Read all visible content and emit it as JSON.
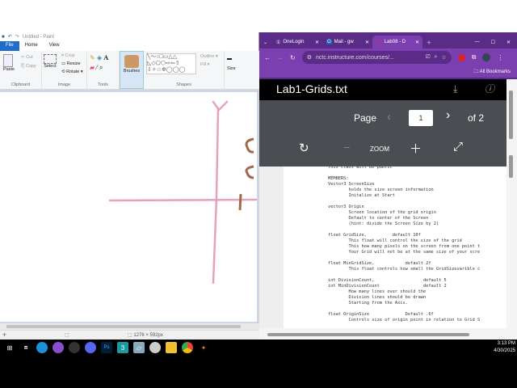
{
  "paint": {
    "title": "Untitled - Paint",
    "tabs": [
      "File",
      "Home",
      "View"
    ],
    "clipboard": {
      "paste": "Paste",
      "cut": "Cut",
      "copy": "Copy",
      "label": "Clipboard"
    },
    "image": {
      "select": "Select",
      "crop": "Crop",
      "resize": "Resize",
      "rotate": "Rotate",
      "label": "Image"
    },
    "tools": {
      "label": "Tools"
    },
    "brushes": "Brushes",
    "shapes": {
      "outline": "Outline",
      "fill": "Fill",
      "label": "Shapes"
    },
    "size": "Size",
    "status": {
      "dimensions": "1276 × 592px"
    },
    "stroke_color": "#e8a0c0",
    "brown": "#a0694a"
  },
  "browser": {
    "tabs": [
      {
        "label": "OneLogin"
      },
      {
        "label": "Mail - gw"
      },
      {
        "label": "Lab08 - D"
      }
    ],
    "url": "nctc.instructure.com/courses/...",
    "bookmarks": "All Bookmarks",
    "doc": {
      "title": "Lab1-Grids.txt",
      "page_label": "Page",
      "page": "1",
      "of": "of 2",
      "zoom": "ZOOM",
      "text": "This class will be public\n\nMEMBERS:\nVector3 ScreenSize\n        holds the size screen information\n        Initalize at Start\n\nvector3 Origin\n        Screen location of the grid origin\n        Default to center of the Screen\n        (hint: divide the Screen Size by 2)\n\nfloat GridSize,          default 10f\n        This float will control the size of the grid\n        This how many pixels on the screen from one point t\n        Your Grid will not be at the same size of your scre\n\nfloat MinGridSize,            default 2f\n        This float controls how small the GridSizevarible c\n\nint DivisionCount,                   default 5\nint MinDivisionCount                 default 2\n        How many lines over should the\n        Division lines should be drawn\n        Starting from the Axis.\n\nfloat OriginSize              Default .6f\n        Controls size of origin point in relation to Grid S"
    }
  },
  "taskbar": {
    "time": "3:13 PM",
    "date": "4/30/2025"
  }
}
